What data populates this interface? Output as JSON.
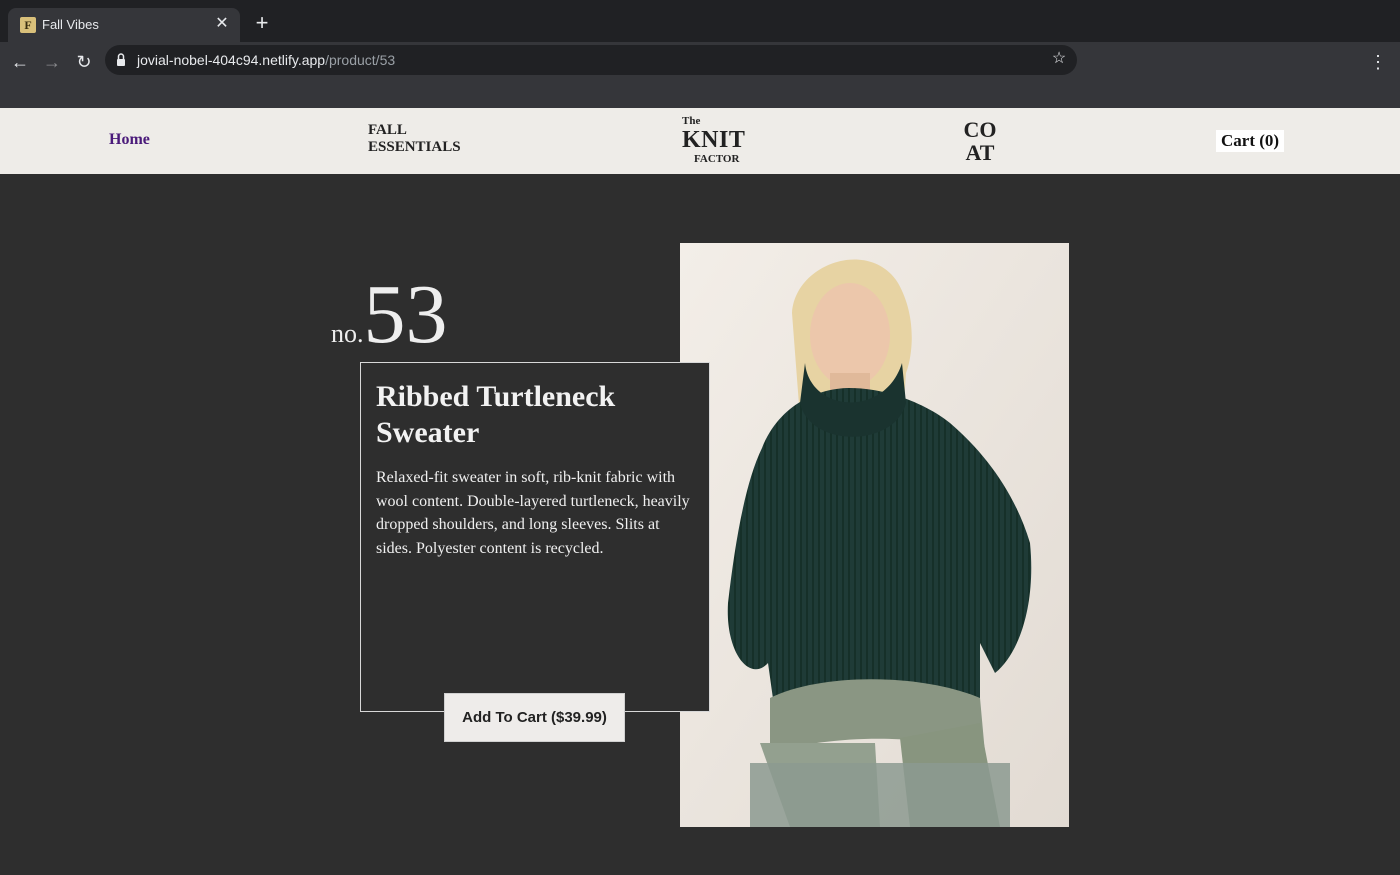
{
  "browser": {
    "tab_title": "Fall Vibes",
    "tab_favicon_letter": "F",
    "tab_close_icon": "close-icon",
    "new_tab_icon": "plus-icon",
    "url_host": "jovial-nobel-404c94.netlify.app",
    "url_path": "/product/53",
    "back_icon": "arrow-left-icon",
    "forward_icon": "arrow-right-icon",
    "reload_icon": "reload-icon",
    "lock_icon": "lock-icon",
    "bookmark_icon": "star-icon",
    "menu_icon": "kebab-menu-icon"
  },
  "header": {
    "home_label": "Home",
    "fall_essentials_line1": "FALL",
    "fall_essentials_line2": "ESSENTIALS",
    "logo_the": "The",
    "logo_knit": "KNIT",
    "logo_factor": "FACTOR",
    "coat_line1": "CO",
    "coat_line2": "AT",
    "cart_label": "Cart (0)"
  },
  "product": {
    "number_prefix": "no.",
    "number": "53",
    "title": "Ribbed Turtleneck Sweater",
    "description": "Relaxed-fit sweater in soft, rib-knit fabric with wool content. Double-layered turtleneck, heavily dropped shoulders, and long sleeves. Slits at sides. Polyester content is recycled.",
    "add_to_cart_label": "Add To Cart ($39.99)"
  },
  "colors": {
    "page_background": "#2e2e2e",
    "header_background": "#eeece8",
    "home_link": "#4a1a7a",
    "sweater": "#1e3a36"
  }
}
